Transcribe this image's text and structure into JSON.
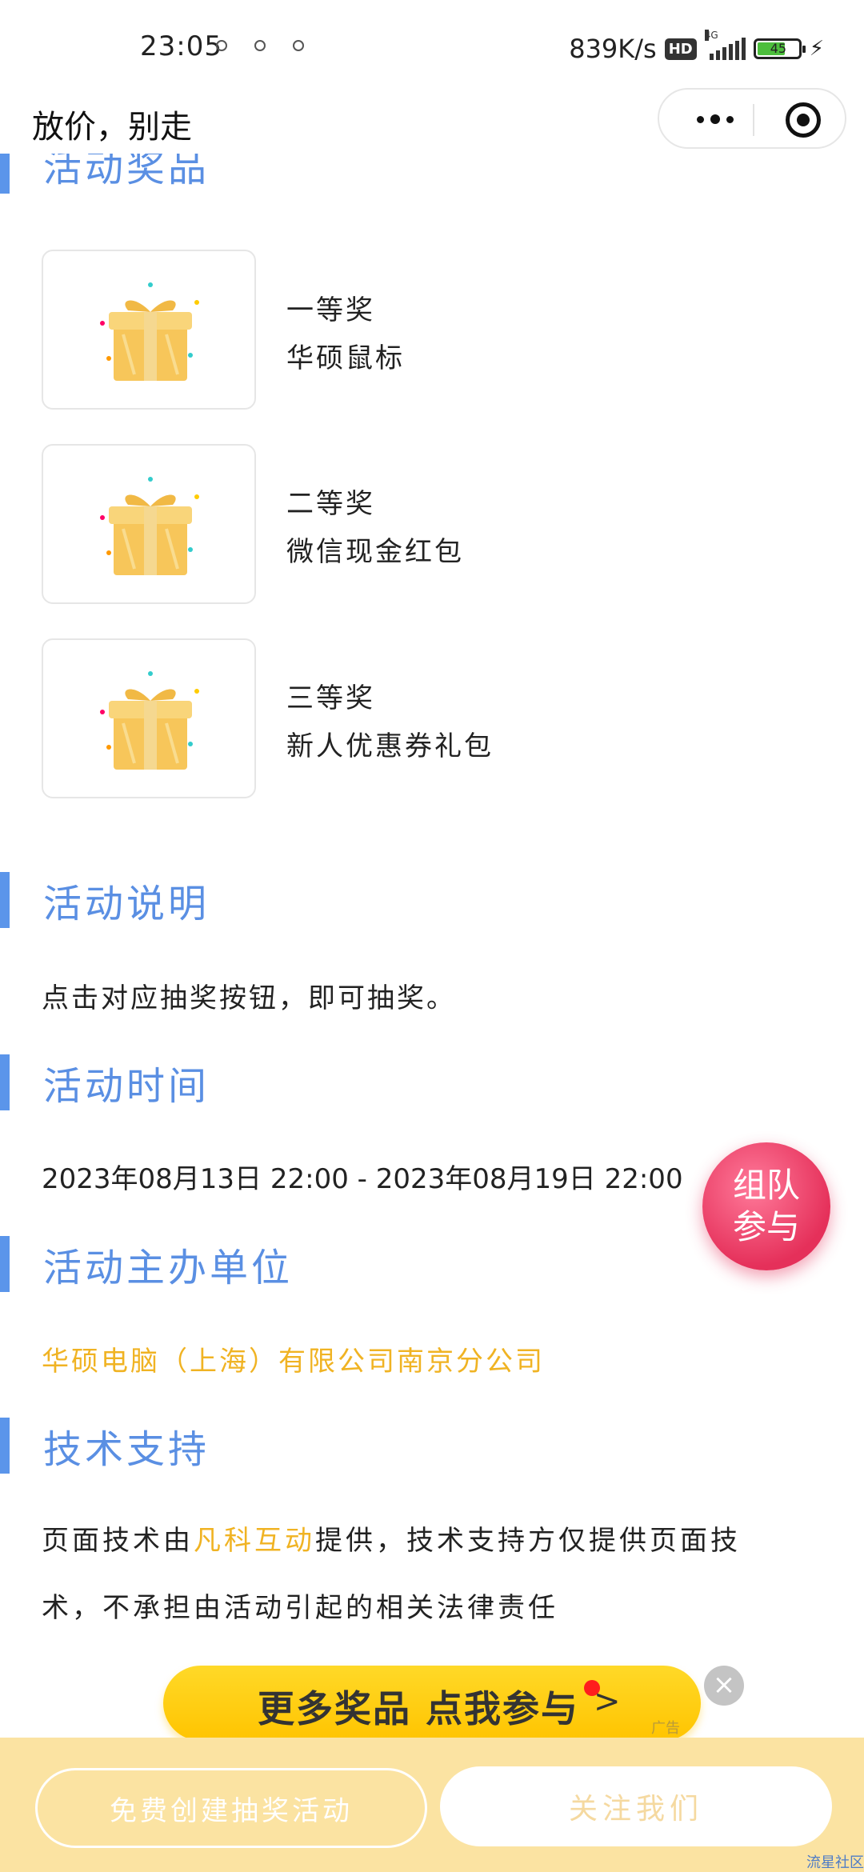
{
  "status_bar": {
    "time": "23:05",
    "net_speed": "839K/s",
    "hd": "HD",
    "network": "4G",
    "battery": "45"
  },
  "navbar": {
    "title": "放价，别走"
  },
  "sections": {
    "prizes_title": "活动奖品",
    "desc_title": "活动说明",
    "time_title": "活动时间",
    "org_title": "活动主办单位",
    "tech_title": "技术支持"
  },
  "prizes": [
    {
      "rank": "一等奖",
      "name": "华硕鼠标"
    },
    {
      "rank": "二等奖",
      "name": "微信现金红包"
    },
    {
      "rank": "三等奖",
      "name": "新人优惠券礼包"
    }
  ],
  "description": "点击对应抽奖按钮，即可抽奖。",
  "time_range": "2023年08月13日 22:00 - 2023年08月19日 22:00",
  "organizer": "华硕电脑（上海）有限公司南京分公司",
  "tech": {
    "prefix": "页面技术由",
    "company": "凡科互动",
    "suffix_line1": "提供，技术支持方仅提供页面技",
    "line2": "术，不承担由活动引起的相关法律责任"
  },
  "team_button": {
    "line1": "组队",
    "line2": "参与"
  },
  "ad": {
    "text": "更多奖品  点我参与",
    "arrow": ">",
    "tag": "广告",
    "close": "×"
  },
  "bottom": {
    "create_label": "免费创建抽奖活动",
    "follow_label": "关注我们"
  },
  "watermark": "流星社区",
  "colors": {
    "accent_blue": "#5b95ea",
    "orange": "#f0b323",
    "team_pink": "#e5305a",
    "ad_yellow": "#ffd928",
    "bottom_bg": "#fbe3a2"
  }
}
